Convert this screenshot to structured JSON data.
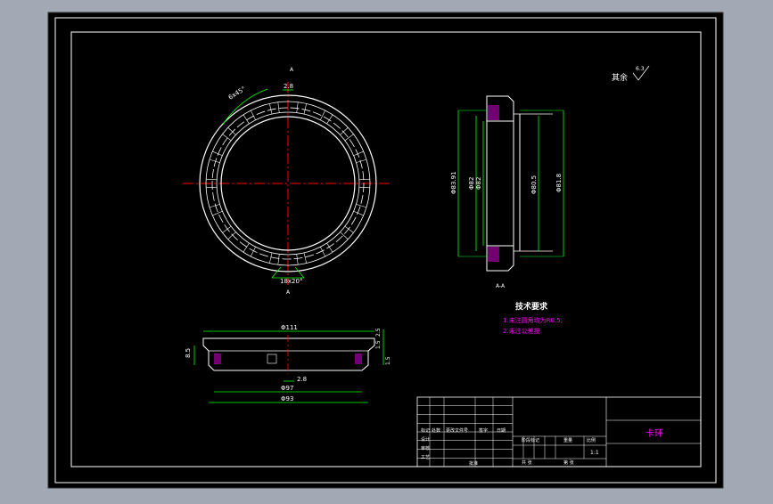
{
  "drawing": {
    "surface_finish": {
      "prefix": "其余",
      "value": "6.3"
    },
    "section_marks": {
      "top": "A",
      "bottom": "A",
      "side": "A-A"
    },
    "front_view": {
      "dim_slot_width": "2.8",
      "dim_angle": "6x45°",
      "dim_bottom": "18x20°"
    },
    "side_view": {
      "dims": [
        "Φ83.91",
        "Φ82",
        "Φ82",
        "Φ80.5",
        "Φ81.8"
      ]
    },
    "bottom_view": {
      "dim_top": "Φ111",
      "dim_mid": "2.8",
      "dim_lower": "Φ97",
      "dim_bottom": "Φ93",
      "dim_left": "8.5",
      "dim_right": [
        "2.5",
        "1.5",
        "1.5"
      ]
    },
    "tech_requirements": {
      "title": "技术要求",
      "items": [
        "1.未注圆角均为R0.5;",
        "2.未注公差按"
      ]
    },
    "title_block": {
      "part_name": "卡环",
      "scale": "1:1",
      "cells": [
        "标记",
        "处数",
        "更改文件号",
        "签字",
        "日期",
        "设计",
        "审核",
        "工艺",
        "批准",
        "阶段标记",
        "重量",
        "比例",
        "共 张",
        "第 张"
      ]
    },
    "colors": {
      "background": "#000000",
      "outline": "#ffffff",
      "dimension": "#00ff00",
      "centerline": "#ff0000",
      "text": "#ffffff",
      "accent": "#ff00ff"
    }
  }
}
